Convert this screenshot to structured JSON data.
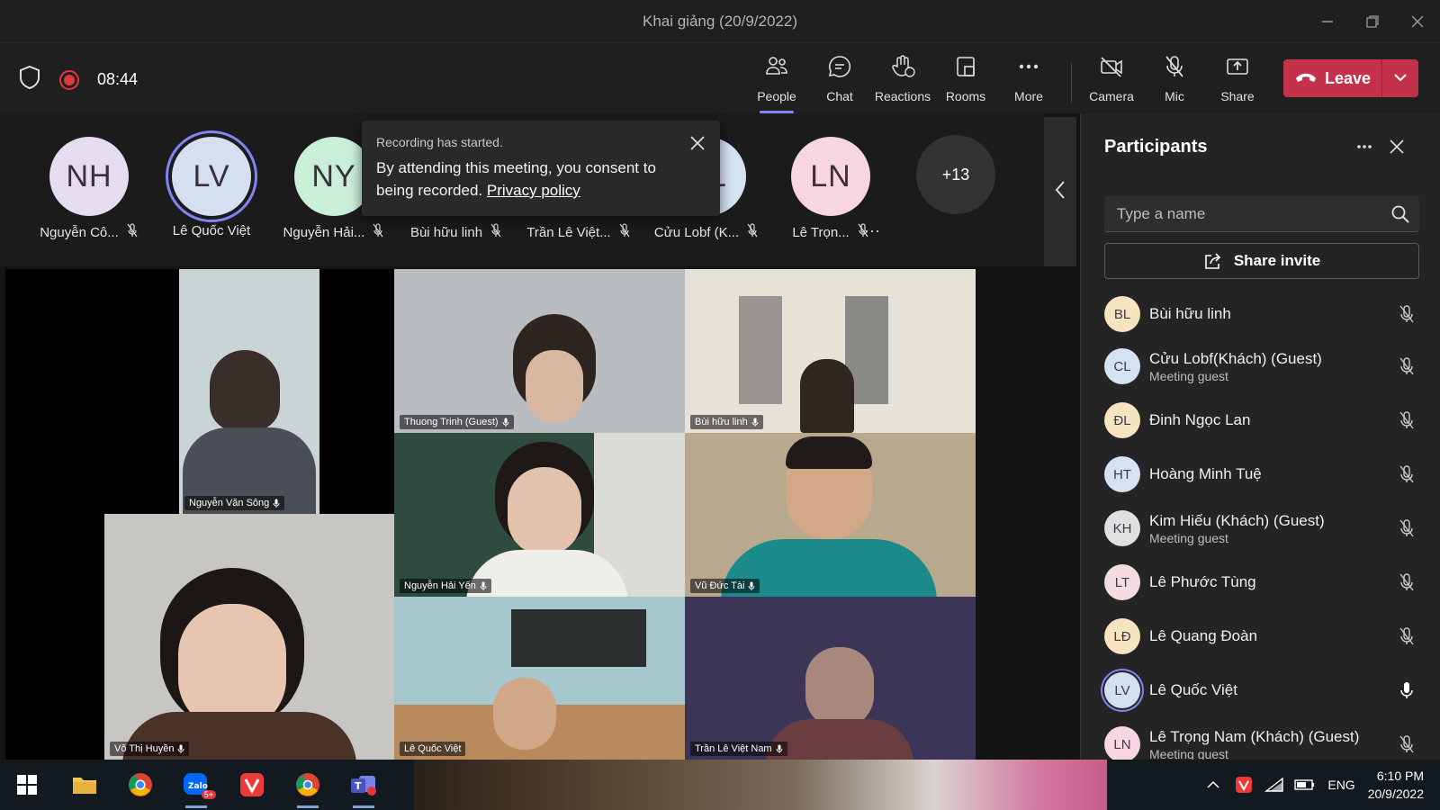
{
  "window": {
    "title": "Khai giảng (20/9/2022)"
  },
  "toolbar": {
    "timer": "08:44",
    "buttons": [
      {
        "label": "People",
        "icon": "people-icon"
      },
      {
        "label": "Chat",
        "icon": "chat-icon"
      },
      {
        "label": "Reactions",
        "icon": "reactions-icon"
      },
      {
        "label": "Rooms",
        "icon": "rooms-icon"
      },
      {
        "label": "More",
        "icon": "more-icon"
      },
      {
        "label": "Camera",
        "icon": "camera-off-icon"
      },
      {
        "label": "Mic",
        "icon": "mic-off-icon"
      },
      {
        "label": "Share",
        "icon": "share-icon"
      }
    ],
    "leave_label": "Leave"
  },
  "strip": {
    "avatars": [
      {
        "initials": "NH",
        "name": "Nguyễn Cô...",
        "color": "#e5dcef"
      },
      {
        "initials": "LV",
        "name": "Lê Quốc Việt",
        "color": "#d4dff2"
      },
      {
        "initials": "NY",
        "name": "Nguyễn Hải...",
        "color": "#c9efd9"
      },
      {
        "initials": "BL",
        "name": "Bùi hữu linh",
        "color": "#f6e3bf"
      },
      {
        "initials": "TV",
        "name": "Trần Lê Việt...",
        "color": "#d2e6f5"
      },
      {
        "initials": "CL",
        "name": "Cửu Lobf (K...",
        "color": "#d5e2f2"
      },
      {
        "initials": "LN",
        "name": "Lê Trọn...",
        "color": "#f7d6e1"
      }
    ],
    "overflow_count": "+13"
  },
  "toast": {
    "title": "Recording has started.",
    "message": "By attending this meeting, you consent to being recorded.",
    "link": "Privacy policy"
  },
  "videos": [
    {
      "name": "Nguyễn Văn Sông"
    },
    {
      "name": "Thuong Trinh (Guest)"
    },
    {
      "name": "Bùi hữu linh"
    },
    {
      "name": "Nguyễn Hải Yến"
    },
    {
      "name": "Vũ Đức Tài"
    },
    {
      "name": "Võ Thị Huyền"
    },
    {
      "name": "Lê Quốc Việt"
    },
    {
      "name": "Trần Lê Việt Nam"
    }
  ],
  "panel": {
    "title": "Participants",
    "search_placeholder": "Type a name",
    "share_invite": "Share invite",
    "participants": [
      {
        "initials": "BL",
        "name": "Bùi hữu linh",
        "sub": "",
        "color": "#f6e3bf",
        "mic": "off"
      },
      {
        "initials": "CL",
        "name": "Cửu Lobf(Khách) (Guest)",
        "sub": "Meeting guest",
        "color": "#d5e2f2",
        "mic": "off"
      },
      {
        "initials": "ĐL",
        "name": "Đinh Ngọc Lan",
        "sub": "",
        "color": "#f6e3bf",
        "mic": "off"
      },
      {
        "initials": "HT",
        "name": "Hoàng Minh Tuệ",
        "sub": "",
        "color": "#d5e2f2",
        "mic": "off"
      },
      {
        "initials": "KH",
        "name": "Kim Hiếu (Khách) (Guest)",
        "sub": "Meeting guest",
        "color": "#e0e0e0",
        "mic": "off"
      },
      {
        "initials": "LT",
        "name": "Lê Phước Tùng",
        "sub": "",
        "color": "#f4dbe0",
        "mic": "off"
      },
      {
        "initials": "LĐ",
        "name": "Lê Quang Đoàn",
        "sub": "",
        "color": "#f6e3bf",
        "mic": "off"
      },
      {
        "initials": "LV",
        "name": "Lê Quốc Việt",
        "sub": "",
        "color": "#d4dff2",
        "mic": "on"
      },
      {
        "initials": "LN",
        "name": "Lê Trọng Nam (Khách) (Guest)",
        "sub": "Meeting guest",
        "color": "#f7d6e1",
        "mic": "off"
      }
    ]
  },
  "taskbar": {
    "apps": [
      "windows-start-icon",
      "file-explorer-icon",
      "chrome-icon",
      "zalo-icon",
      "vivaldi-icon",
      "chrome-profile-icon",
      "teams-icon"
    ],
    "zalo_badge": "5+",
    "lang": "ENG",
    "time": "6:10 PM",
    "date": "20/9/2022"
  },
  "colors": {
    "accent": "#7f85f5",
    "leave": "#c4314b",
    "record": "#e2373f"
  }
}
